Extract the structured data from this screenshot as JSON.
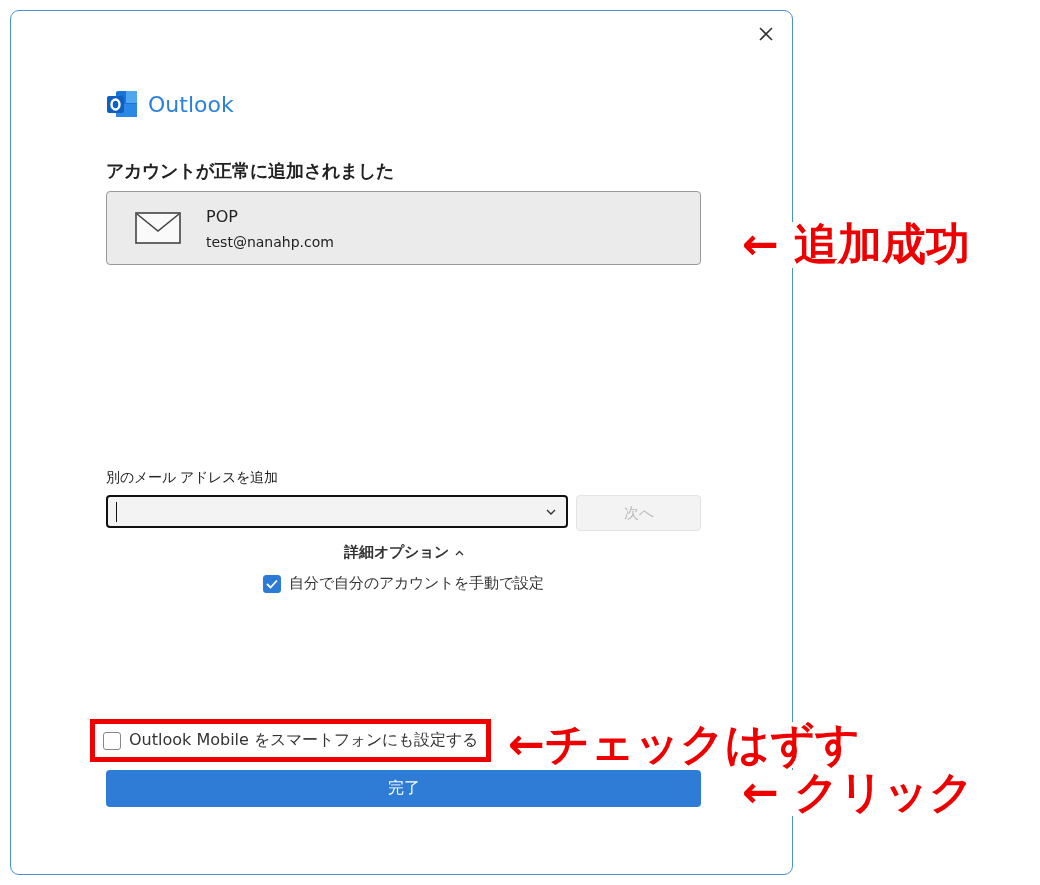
{
  "dialog": {
    "brand": "Outlook",
    "heading": "アカウントが正常に追加されました",
    "account": {
      "type": "POP",
      "email": "test@nanahp.com"
    },
    "add_address": {
      "label": "別のメール アドレスを追加",
      "next_button": {
        "label": "次へ",
        "disabled": true
      }
    },
    "advanced_options": {
      "label": "詳細オプション",
      "expanded": true,
      "manual_setup": {
        "label": "自分で自分のアカウントを手動で設定",
        "checked": true
      }
    },
    "mobile_setup": {
      "label": "Outlook Mobile をスマートフォンにも設定する",
      "checked": false,
      "highlighted": true
    },
    "done_button": "完了"
  },
  "annotations": [
    "← 追加成功",
    "←チェックはずす",
    "← クリック"
  ]
}
